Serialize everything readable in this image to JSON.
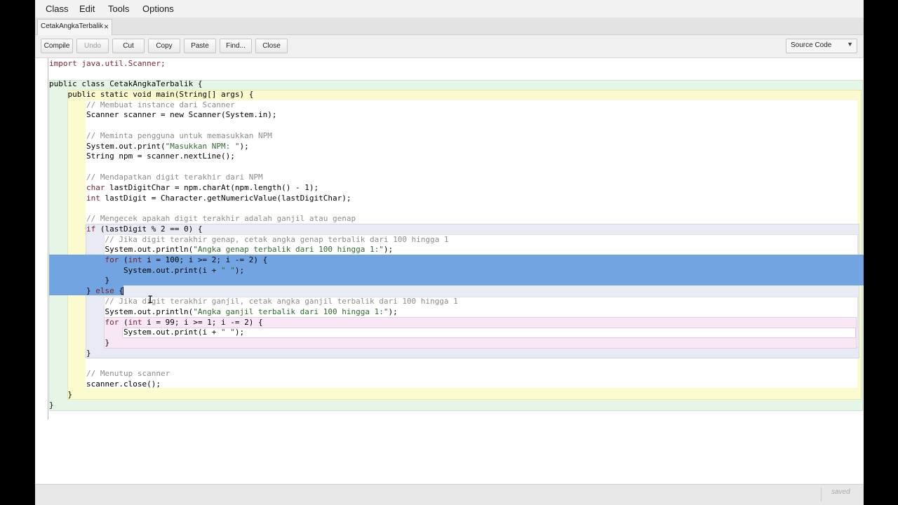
{
  "menu": [
    "Class",
    "Edit",
    "Tools",
    "Options"
  ],
  "tab": {
    "label": "CetakAngkaTerbalik",
    "close": "×"
  },
  "toolbar": {
    "compile": "Compile",
    "undo": "Undo",
    "cut": "Cut",
    "copy": "Copy",
    "paste": "Paste",
    "find": "Find...",
    "close": "Close",
    "view": "Source Code",
    "view_arrow": "▼"
  },
  "code": {
    "l1": "import java.util.Scanner;",
    "l3": "public class CetakAngkaTerbalik {",
    "l4": "    public static void main(String[] args) {",
    "l5": "        // Membuat instance dari Scanner",
    "l6": "        Scanner scanner = new Scanner(System.in);",
    "l8": "        // Meminta pengguna untuk memasukkan NPM",
    "l9a": "        System.out.print(",
    "l9b": "\"Masukkan NPM: \"",
    "l9c": ");",
    "l10": "        String npm = scanner.nextLine();",
    "l12": "        // Mendapatkan digit terakhir dari NPM",
    "l13a": "        char",
    "l13b": " lastDigitChar = npm.charAt(npm.length() - 1);",
    "l14a": "        int",
    "l14b": " lastDigit = Character.getNumericValue(lastDigitChar);",
    "l16": "        // Mengecek apakah digit terakhir adalah ganjil atau genap",
    "l17a": "        if",
    "l17b": " (lastDigit % 2 == 0) {",
    "l18": "            // Jika digit terakhir genap, cetak angka genap terbalik dari 100 hingga 1",
    "l19a": "            System.out.println(",
    "l19b": "\"Angka genap terbalik dari 100 hingga 1:\"",
    "l19c": ");",
    "l20a": "            for",
    "l20b": " (",
    "l20c": "int",
    "l20d": " i = 100; i >= 2; i -= 2) {",
    "l21a": "                System.out.print(i + ",
    "l21b": "\" \"",
    "l21c": ");",
    "l22": "            }",
    "l23a": "        } ",
    "l23b": "else",
    "l23c": " {",
    "l24": "            // Jika digit terakhir ganjil, cetak angka ganjil terbalik dari 100 hingga 1",
    "l25a": "            System.out.println(",
    "l25b": "\"Angka ganjil terbalik dari 100 hingga 1:\"",
    "l25c": ");",
    "l26a": "            for",
    "l26b": " (",
    "l26c": "int",
    "l26d": " i = 99; i >= 1; i -= 2) {",
    "l27a": "                System.out.print(i + ",
    "l27b": "\" \"",
    "l27c": ");",
    "l28": "            }",
    "l29": "        }",
    "l31": "        // Menutup scanner",
    "l32": "        scanner.close();",
    "l33": "    }",
    "l34": "}"
  },
  "status": "saved"
}
